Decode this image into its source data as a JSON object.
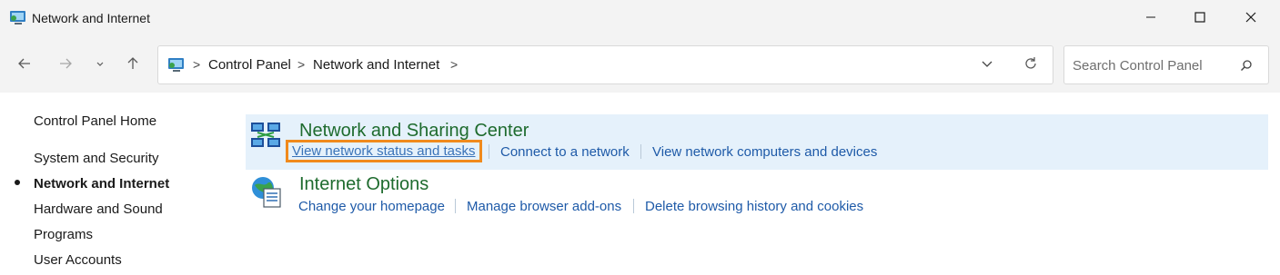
{
  "window": {
    "title": "Network and Internet",
    "controls": [
      "minimize-icon",
      "maximize-icon",
      "close-icon"
    ]
  },
  "nav": {
    "back_icon": "arrow-left-icon",
    "forward_icon": "arrow-right-icon",
    "recent_icon": "chevron-down-icon",
    "up_icon": "arrow-up-icon"
  },
  "address": {
    "crumbs": [
      "Control Panel",
      "Network and Internet"
    ],
    "separator": ">"
  },
  "search": {
    "placeholder": "Search Control Panel"
  },
  "sidebar": {
    "items": [
      {
        "label": "Control Panel Home"
      },
      {
        "label": "System and Security"
      },
      {
        "label": "Network and Internet",
        "active": true
      },
      {
        "label": "Hardware and Sound"
      },
      {
        "label": "Programs"
      },
      {
        "label": "User Accounts"
      }
    ]
  },
  "categories": [
    {
      "title": "Network and Sharing Center",
      "icon": "network-sharing-icon",
      "links": [
        "View network status and tasks",
        "Connect to a network",
        "View network computers and devices"
      ]
    },
    {
      "title": "Internet Options",
      "icon": "internet-options-icon",
      "links": [
        "Change your homepage",
        "Manage browser add-ons",
        "Delete browsing history and cookies"
      ]
    }
  ],
  "colors": {
    "accent_green": "#1e6b2e",
    "link_blue": "#1e5aa8",
    "highlight_bg": "#e5f1fb",
    "focus_orange": "#f08a1c"
  }
}
